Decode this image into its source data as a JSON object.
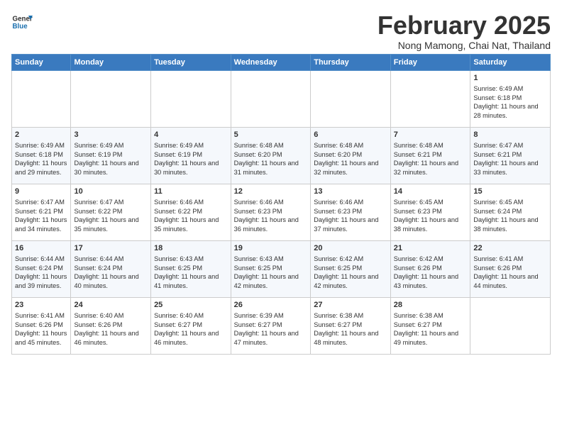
{
  "header": {
    "logo_line1": "General",
    "logo_line2": "Blue",
    "title": "February 2025",
    "subtitle": "Nong Mamong, Chai Nat, Thailand"
  },
  "weekdays": [
    "Sunday",
    "Monday",
    "Tuesday",
    "Wednesday",
    "Thursday",
    "Friday",
    "Saturday"
  ],
  "weeks": [
    [
      {
        "day": "",
        "info": ""
      },
      {
        "day": "",
        "info": ""
      },
      {
        "day": "",
        "info": ""
      },
      {
        "day": "",
        "info": ""
      },
      {
        "day": "",
        "info": ""
      },
      {
        "day": "",
        "info": ""
      },
      {
        "day": "1",
        "info": "Sunrise: 6:49 AM\nSunset: 6:18 PM\nDaylight: 11 hours and 28 minutes."
      }
    ],
    [
      {
        "day": "2",
        "info": "Sunrise: 6:49 AM\nSunset: 6:18 PM\nDaylight: 11 hours and 29 minutes."
      },
      {
        "day": "3",
        "info": "Sunrise: 6:49 AM\nSunset: 6:19 PM\nDaylight: 11 hours and 30 minutes."
      },
      {
        "day": "4",
        "info": "Sunrise: 6:49 AM\nSunset: 6:19 PM\nDaylight: 11 hours and 30 minutes."
      },
      {
        "day": "5",
        "info": "Sunrise: 6:48 AM\nSunset: 6:20 PM\nDaylight: 11 hours and 31 minutes."
      },
      {
        "day": "6",
        "info": "Sunrise: 6:48 AM\nSunset: 6:20 PM\nDaylight: 11 hours and 32 minutes."
      },
      {
        "day": "7",
        "info": "Sunrise: 6:48 AM\nSunset: 6:21 PM\nDaylight: 11 hours and 32 minutes."
      },
      {
        "day": "8",
        "info": "Sunrise: 6:47 AM\nSunset: 6:21 PM\nDaylight: 11 hours and 33 minutes."
      }
    ],
    [
      {
        "day": "9",
        "info": "Sunrise: 6:47 AM\nSunset: 6:21 PM\nDaylight: 11 hours and 34 minutes."
      },
      {
        "day": "10",
        "info": "Sunrise: 6:47 AM\nSunset: 6:22 PM\nDaylight: 11 hours and 35 minutes."
      },
      {
        "day": "11",
        "info": "Sunrise: 6:46 AM\nSunset: 6:22 PM\nDaylight: 11 hours and 35 minutes."
      },
      {
        "day": "12",
        "info": "Sunrise: 6:46 AM\nSunset: 6:23 PM\nDaylight: 11 hours and 36 minutes."
      },
      {
        "day": "13",
        "info": "Sunrise: 6:46 AM\nSunset: 6:23 PM\nDaylight: 11 hours and 37 minutes."
      },
      {
        "day": "14",
        "info": "Sunrise: 6:45 AM\nSunset: 6:23 PM\nDaylight: 11 hours and 38 minutes."
      },
      {
        "day": "15",
        "info": "Sunrise: 6:45 AM\nSunset: 6:24 PM\nDaylight: 11 hours and 38 minutes."
      }
    ],
    [
      {
        "day": "16",
        "info": "Sunrise: 6:44 AM\nSunset: 6:24 PM\nDaylight: 11 hours and 39 minutes."
      },
      {
        "day": "17",
        "info": "Sunrise: 6:44 AM\nSunset: 6:24 PM\nDaylight: 11 hours and 40 minutes."
      },
      {
        "day": "18",
        "info": "Sunrise: 6:43 AM\nSunset: 6:25 PM\nDaylight: 11 hours and 41 minutes."
      },
      {
        "day": "19",
        "info": "Sunrise: 6:43 AM\nSunset: 6:25 PM\nDaylight: 11 hours and 42 minutes."
      },
      {
        "day": "20",
        "info": "Sunrise: 6:42 AM\nSunset: 6:25 PM\nDaylight: 11 hours and 42 minutes."
      },
      {
        "day": "21",
        "info": "Sunrise: 6:42 AM\nSunset: 6:26 PM\nDaylight: 11 hours and 43 minutes."
      },
      {
        "day": "22",
        "info": "Sunrise: 6:41 AM\nSunset: 6:26 PM\nDaylight: 11 hours and 44 minutes."
      }
    ],
    [
      {
        "day": "23",
        "info": "Sunrise: 6:41 AM\nSunset: 6:26 PM\nDaylight: 11 hours and 45 minutes."
      },
      {
        "day": "24",
        "info": "Sunrise: 6:40 AM\nSunset: 6:26 PM\nDaylight: 11 hours and 46 minutes."
      },
      {
        "day": "25",
        "info": "Sunrise: 6:40 AM\nSunset: 6:27 PM\nDaylight: 11 hours and 46 minutes."
      },
      {
        "day": "26",
        "info": "Sunrise: 6:39 AM\nSunset: 6:27 PM\nDaylight: 11 hours and 47 minutes."
      },
      {
        "day": "27",
        "info": "Sunrise: 6:38 AM\nSunset: 6:27 PM\nDaylight: 11 hours and 48 minutes."
      },
      {
        "day": "28",
        "info": "Sunrise: 6:38 AM\nSunset: 6:27 PM\nDaylight: 11 hours and 49 minutes."
      },
      {
        "day": "",
        "info": ""
      }
    ]
  ]
}
